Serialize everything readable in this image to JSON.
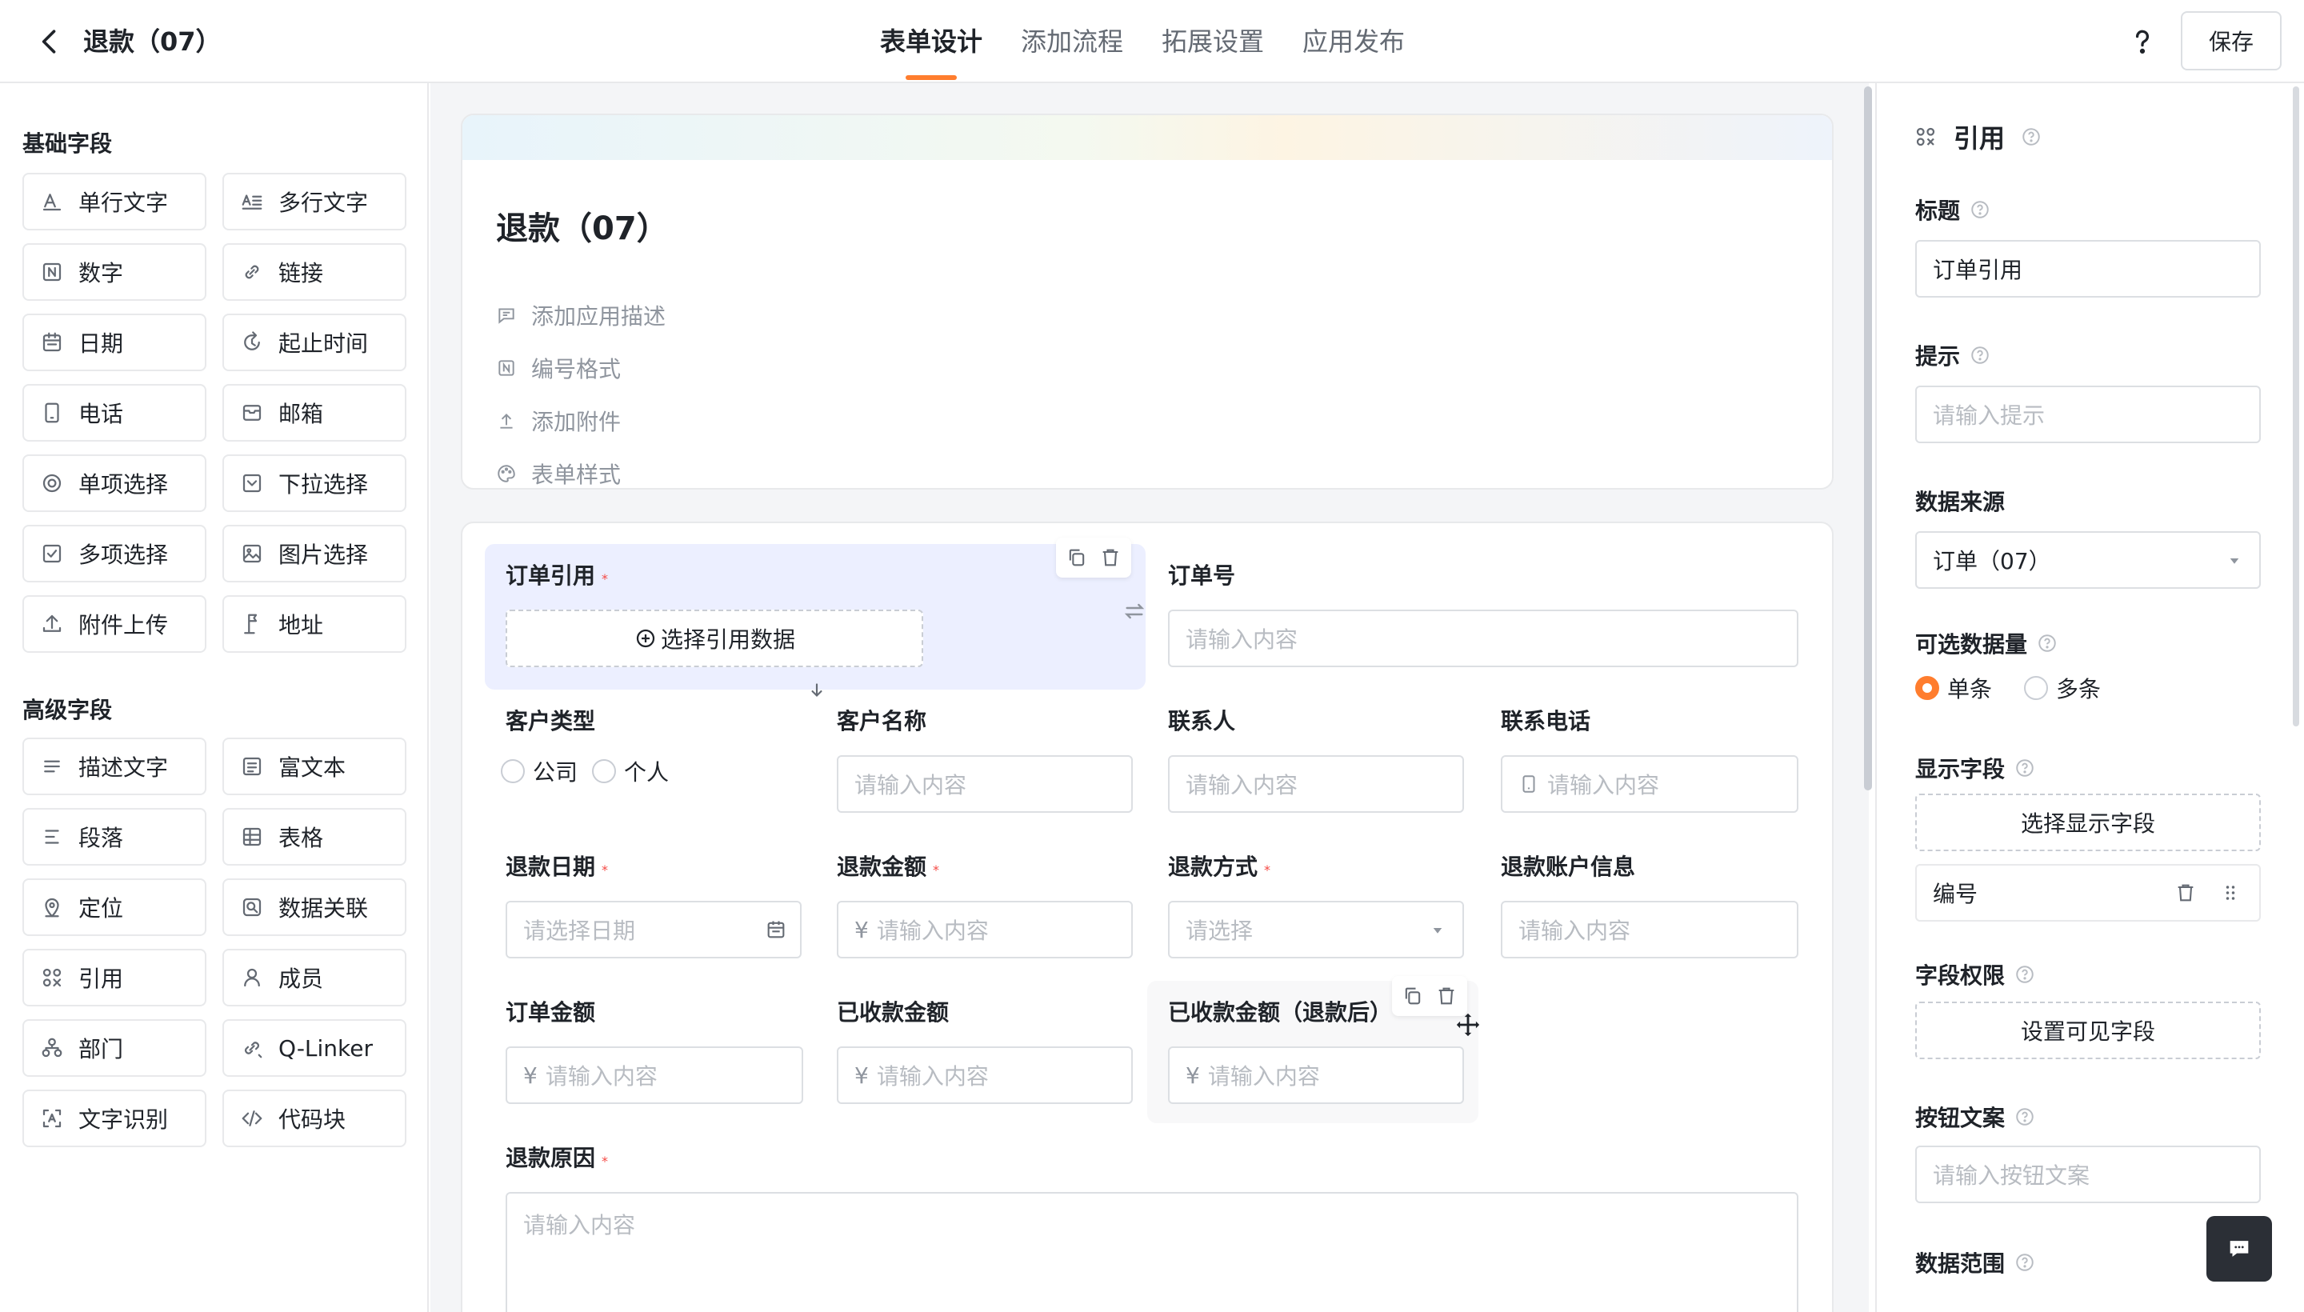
{
  "topbar": {
    "title": "退款（07）",
    "tabs": [
      "表单设计",
      "添加流程",
      "拓展设置",
      "应用发布"
    ],
    "active_tab": 0,
    "save_label": "保存",
    "accent": "#ff7d2e"
  },
  "left_panel": {
    "basic_title": "基础字段",
    "basic_fields": [
      {
        "label": "单行文字",
        "icon": "single-line-text-icon"
      },
      {
        "label": "多行文字",
        "icon": "multi-line-text-icon"
      },
      {
        "label": "数字",
        "icon": "number-icon"
      },
      {
        "label": "链接",
        "icon": "link-icon"
      },
      {
        "label": "日期",
        "icon": "date-icon"
      },
      {
        "label": "起止时间",
        "icon": "time-range-icon"
      },
      {
        "label": "电话",
        "icon": "phone-icon"
      },
      {
        "label": "邮箱",
        "icon": "email-icon"
      },
      {
        "label": "单项选择",
        "icon": "radio-icon"
      },
      {
        "label": "下拉选择",
        "icon": "dropdown-icon"
      },
      {
        "label": "多项选择",
        "icon": "checkbox-icon"
      },
      {
        "label": "图片选择",
        "icon": "image-icon"
      },
      {
        "label": "附件上传",
        "icon": "upload-icon"
      },
      {
        "label": "地址",
        "icon": "address-icon"
      }
    ],
    "advanced_title": "高级字段",
    "advanced_fields": [
      {
        "label": "描述文字",
        "icon": "description-icon"
      },
      {
        "label": "富文本",
        "icon": "rich-text-icon"
      },
      {
        "label": "段落",
        "icon": "paragraph-icon"
      },
      {
        "label": "表格",
        "icon": "table-icon"
      },
      {
        "label": "定位",
        "icon": "location-icon"
      },
      {
        "label": "数据关联",
        "icon": "data-link-icon"
      },
      {
        "label": "引用",
        "icon": "reference-icon"
      },
      {
        "label": "成员",
        "icon": "member-icon"
      },
      {
        "label": "部门",
        "icon": "department-icon"
      },
      {
        "label": "Q-Linker",
        "icon": "q-linker-icon"
      },
      {
        "label": "文字识别",
        "icon": "ocr-icon"
      },
      {
        "label": "代码块",
        "icon": "code-icon"
      }
    ]
  },
  "form_header": {
    "title": "退款（07）",
    "meta": [
      "添加应用描述",
      "编号格式",
      "添加附件",
      "表单样式"
    ]
  },
  "form": {
    "order_ref": {
      "label": "订单引用",
      "button": "选择引用数据"
    },
    "order_no": {
      "label": "订单号",
      "placeholder": "请输入内容"
    },
    "customer_type": {
      "label": "客户类型",
      "options": [
        "公司",
        "个人"
      ]
    },
    "customer_name": {
      "label": "客户名称",
      "placeholder": "请输入内容"
    },
    "contact": {
      "label": "联系人",
      "placeholder": "请输入内容"
    },
    "contact_phone": {
      "label": "联系电话",
      "placeholder": "请输入内容"
    },
    "refund_date": {
      "label": "退款日期",
      "placeholder": "请选择日期"
    },
    "refund_amount": {
      "label": "退款金额",
      "prefix": "¥",
      "placeholder": "请输入内容"
    },
    "refund_method": {
      "label": "退款方式",
      "placeholder": "请选择"
    },
    "refund_account": {
      "label": "退款账户信息",
      "placeholder": "请输入内容"
    },
    "order_amount": {
      "label": "订单金额",
      "prefix": "¥",
      "placeholder": "请输入内容"
    },
    "received_amount": {
      "label": "已收款金额",
      "prefix": "¥",
      "placeholder": "请输入内容"
    },
    "received_after": {
      "label": "已收款金额（退款后）",
      "prefix": "¥",
      "placeholder": "请输入内容"
    },
    "refund_reason": {
      "label": "退款原因",
      "placeholder": "请输入内容"
    }
  },
  "right_panel": {
    "title": "引用",
    "title_label": "标题",
    "title_value": "订单引用",
    "hint_label": "提示",
    "hint_placeholder": "请输入提示",
    "source_label": "数据来源",
    "source_value": "订单（07）",
    "count_label": "可选数据量",
    "count_options": [
      "单条",
      "多条"
    ],
    "count_selected": 0,
    "display_label": "显示字段",
    "display_button": "选择显示字段",
    "display_item": "编号",
    "perm_label": "字段权限",
    "perm_button": "设置可见字段",
    "btn_text_label": "按钮文案",
    "btn_text_placeholder": "请输入按钮文案",
    "range_label": "数据范围"
  }
}
